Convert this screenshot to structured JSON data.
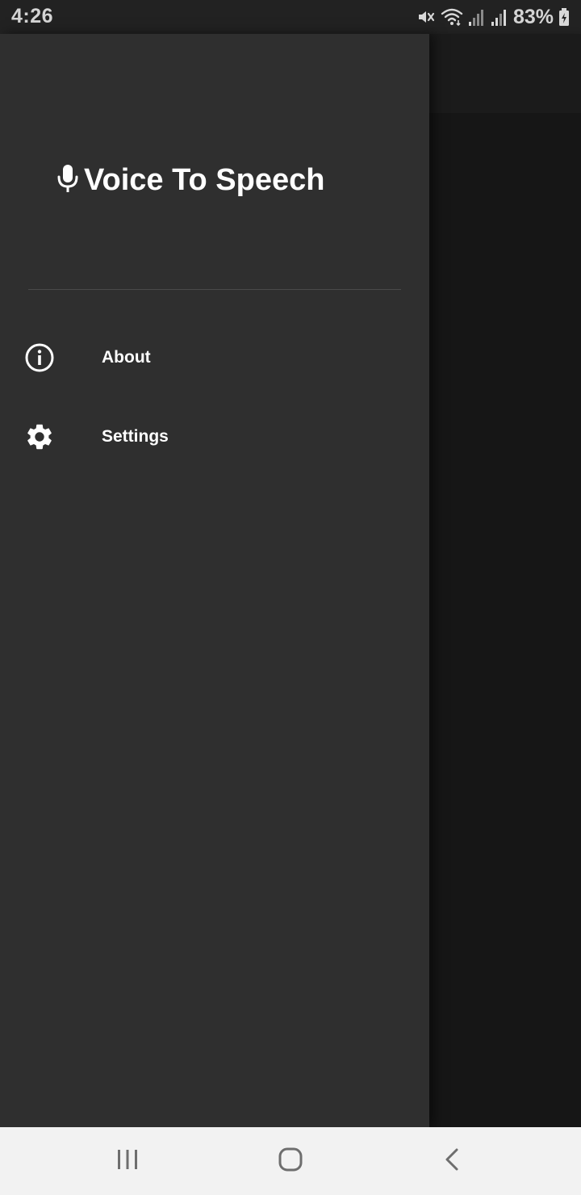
{
  "status_bar": {
    "time": "4:26",
    "battery_percent": "83%",
    "icons": [
      "mute-icon",
      "wifi-icon",
      "signal-icon",
      "signal-icon",
      "battery-charging-icon"
    ]
  },
  "drawer": {
    "title": "Voice To Speech",
    "title_icon": "microphone-icon",
    "items": [
      {
        "label": "About",
        "icon": "info-icon"
      },
      {
        "label": "Settings",
        "icon": "gear-icon"
      }
    ]
  },
  "nav_bar": {
    "buttons": [
      "recents-icon",
      "home-icon",
      "back-icon"
    ]
  },
  "colors": {
    "drawer_bg": "#2f2f2f",
    "scrim_bg": "#161616",
    "text": "#ffffff",
    "nav_bg": "#f2f2f2"
  }
}
